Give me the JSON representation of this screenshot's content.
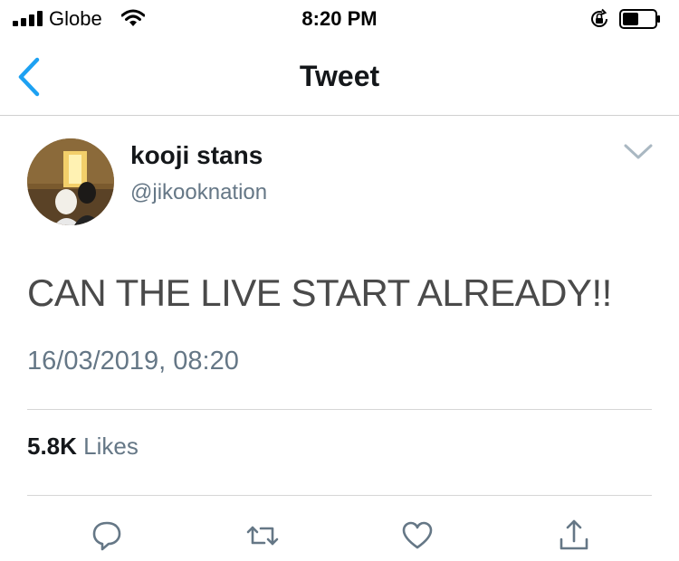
{
  "status_bar": {
    "carrier": "Globe",
    "time": "8:20 PM",
    "icons": [
      "signal-icon",
      "wifi-icon",
      "rotation-lock-icon",
      "battery-icon"
    ]
  },
  "nav": {
    "title": "Tweet",
    "back_icon": "chevron-left-icon",
    "accent_color": "#1da1f2"
  },
  "tweet": {
    "display_name": "kooji stans",
    "handle": "@jikooknation",
    "text": "CAN THE LIVE START ALREADY!!",
    "timestamp": "16/03/2019, 08:20",
    "likes_count": "5.8K",
    "likes_label": "Likes",
    "menu_icon": "chevron-down-icon"
  },
  "actions": [
    {
      "name": "reply",
      "icon": "reply-icon"
    },
    {
      "name": "retweet",
      "icon": "retweet-icon"
    },
    {
      "name": "like",
      "icon": "heart-icon"
    },
    {
      "name": "share",
      "icon": "share-icon"
    }
  ],
  "colors": {
    "text_primary": "#14171a",
    "text_secondary": "#657786",
    "divider": "#d6d6d6",
    "accent": "#1da1f2"
  }
}
